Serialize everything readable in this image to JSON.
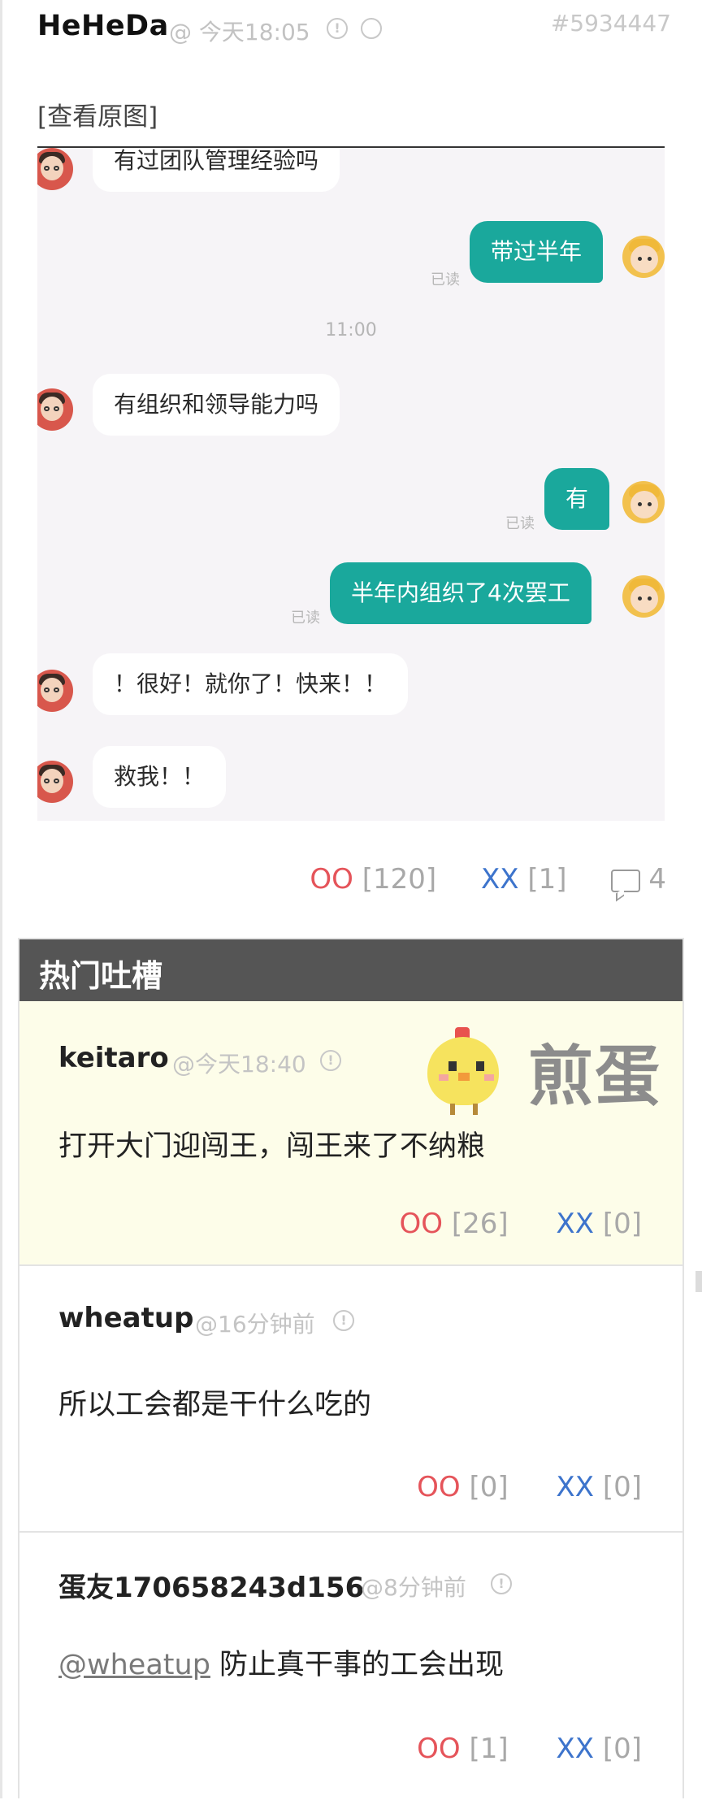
{
  "post": {
    "author": "HeHeDa",
    "time": "@ 今天18:05",
    "number": "#5934447",
    "view_original": "[查看原图]",
    "votes": {
      "oo_label": "OO",
      "oo_count": "[120]",
      "xx_label": "XX",
      "xx_count": "[1]"
    },
    "comment_count": "4"
  },
  "chat_image": {
    "messages": [
      {
        "side": "left",
        "text": "有过团队管理经验吗"
      },
      {
        "side": "right",
        "text": "带过半年",
        "status": "已读"
      },
      {
        "type": "time",
        "text": "11:00"
      },
      {
        "side": "left",
        "text": "有组织和领导能力吗"
      },
      {
        "side": "right",
        "text": "有",
        "status": "已读"
      },
      {
        "side": "right",
        "text": "半年内组织了4次罢工",
        "status": "已读"
      },
      {
        "side": "left",
        "text": "！很好！就你了！快来！！"
      },
      {
        "side": "left",
        "text": "救我！！"
      }
    ]
  },
  "hot_comments": {
    "title": "热门吐槽",
    "logo_text": "煎蛋",
    "items": [
      {
        "author": "keitaro",
        "time": "@今天18:40",
        "text": "打开大门迎闯王，闯王来了不纳粮",
        "oo": "OO",
        "oo_count": "[26]",
        "xx": "XX",
        "xx_count": "[0]"
      },
      {
        "author": "wheatup",
        "time": "@16分钟前",
        "text": "所以工会都是干什么吃的",
        "oo": "OO",
        "oo_count": "[0]",
        "xx": "XX",
        "xx_count": "[0]"
      },
      {
        "author": "蛋友170658243d156",
        "time": "@8分钟前",
        "mention": "@wheatup",
        "text": " 防止真干事的工会出现",
        "oo": "OO",
        "oo_count": "[1]",
        "xx": "XX",
        "xx_count": "[0]"
      }
    ]
  },
  "colors": {
    "oo": "#e5545a",
    "xx": "#3d74cc",
    "bubble_right": "#1aa89c",
    "hot_header": "#555555",
    "highlight": "#fdfde9"
  }
}
